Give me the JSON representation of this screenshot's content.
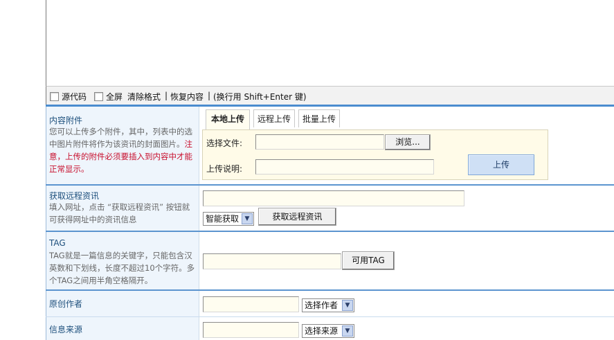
{
  "toolbar": {
    "source_code_label": "源代码",
    "fullscreen_label": "全屏",
    "clear_format_label": "清除格式",
    "divider": "|",
    "restore_label": "恢复内容",
    "hint": "(换行用 Shift+Enter 键)"
  },
  "attachments": {
    "title": "内容附件",
    "desc_normal": "您可以上传多个附件，其中，列表中的选中图片附件将作为该资讯的封面图片。",
    "desc_warning": "注意，上传的附件必须要插入到内容中才能正常显示。",
    "tabs": [
      "本地上传",
      "远程上传",
      "批量上传"
    ],
    "select_file_label": "选择文件:",
    "browse_label": "浏览...",
    "upload_desc_label": "上传说明:",
    "upload_button": "上传"
  },
  "remote": {
    "title": "获取远程资讯",
    "desc": "填入网址，点击 “获取远程资讯” 按钮就可获得网址中的资讯信息",
    "mode_selected": "智能获取",
    "fetch_button": "获取远程资讯"
  },
  "tag": {
    "title": "TAG",
    "desc": "TAG就是一篇信息的关键字，只能包含汉英数和下划线，长度不超过10个字符。多个TAG之间用半角空格隔开。",
    "available_button": "可用TAG"
  },
  "author": {
    "title": "原创作者",
    "select_selected": "选择作者"
  },
  "source": {
    "title": "信息来源",
    "select_selected": "选择来源"
  },
  "icons": {
    "select_arrow": "chevron-down-icon"
  },
  "colors": {
    "accent_blue": "#4a8ccf",
    "warning_red": "#c8102e",
    "label_blue": "#1d4f7c"
  }
}
